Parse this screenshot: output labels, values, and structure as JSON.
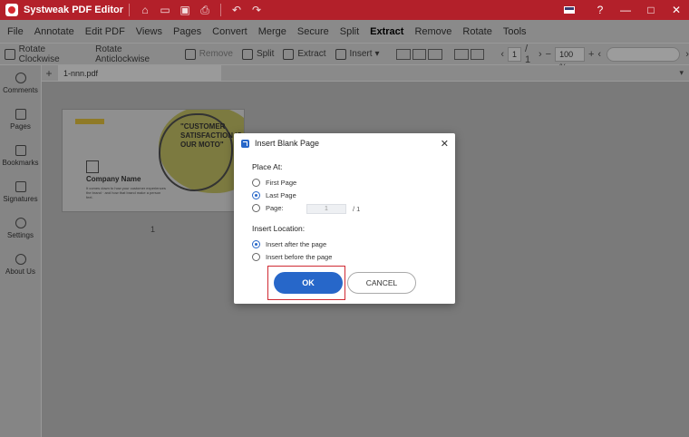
{
  "app": {
    "title": "Systweak PDF Editor"
  },
  "menu": [
    "File",
    "Annotate",
    "Edit PDF",
    "Views",
    "Pages",
    "Convert",
    "Merge",
    "Secure",
    "Split",
    "Extract",
    "Remove",
    "Rotate",
    "Tools"
  ],
  "active_menu": "Extract",
  "toolbar": {
    "rotate_cw": "Rotate Clockwise",
    "rotate_ccw": "Rotate Anticlockwise",
    "remove": "Remove",
    "split": "Split",
    "extract": "Extract",
    "insert": "Insert",
    "insert_arrow": "▾",
    "page_current": "1",
    "page_total": "/ 1",
    "zoom": "100 %"
  },
  "sidebar": {
    "items": [
      {
        "label": "Comments",
        "icon": "comment-icon"
      },
      {
        "label": "Pages",
        "icon": "pages-icon"
      },
      {
        "label": "Bookmarks",
        "icon": "bookmark-icon"
      },
      {
        "label": "Signatures",
        "icon": "signature-icon"
      },
      {
        "label": "Settings",
        "icon": "settings-icon"
      },
      {
        "label": "About Us",
        "icon": "info-icon"
      }
    ]
  },
  "tabs": {
    "add": "+",
    "file": "1-nnn.pdf",
    "more": "▾"
  },
  "thumbnail": {
    "quote": "\"CUSTOMER SATISFACTION IS OUR MOTO\"",
    "company": "Company Name",
    "desc": "It comes down to how your customer experiences the brand · and how that brand make a person feel.",
    "page_label": "1"
  },
  "dialog": {
    "title": "Insert Blank Page",
    "place_at_label": "Place At:",
    "first_page": "First Page",
    "last_page": "Last Page",
    "page": "Page:",
    "page_value": "1",
    "page_total": "/ 1",
    "insert_location_label": "Insert Location:",
    "after": "Insert after the page",
    "before": "Insert before the page",
    "ok": "OK",
    "cancel": "CANCEL"
  },
  "colors": {
    "title_bar": "#b3202a",
    "primary": "#2767c9",
    "highlight": "#d02a33"
  }
}
